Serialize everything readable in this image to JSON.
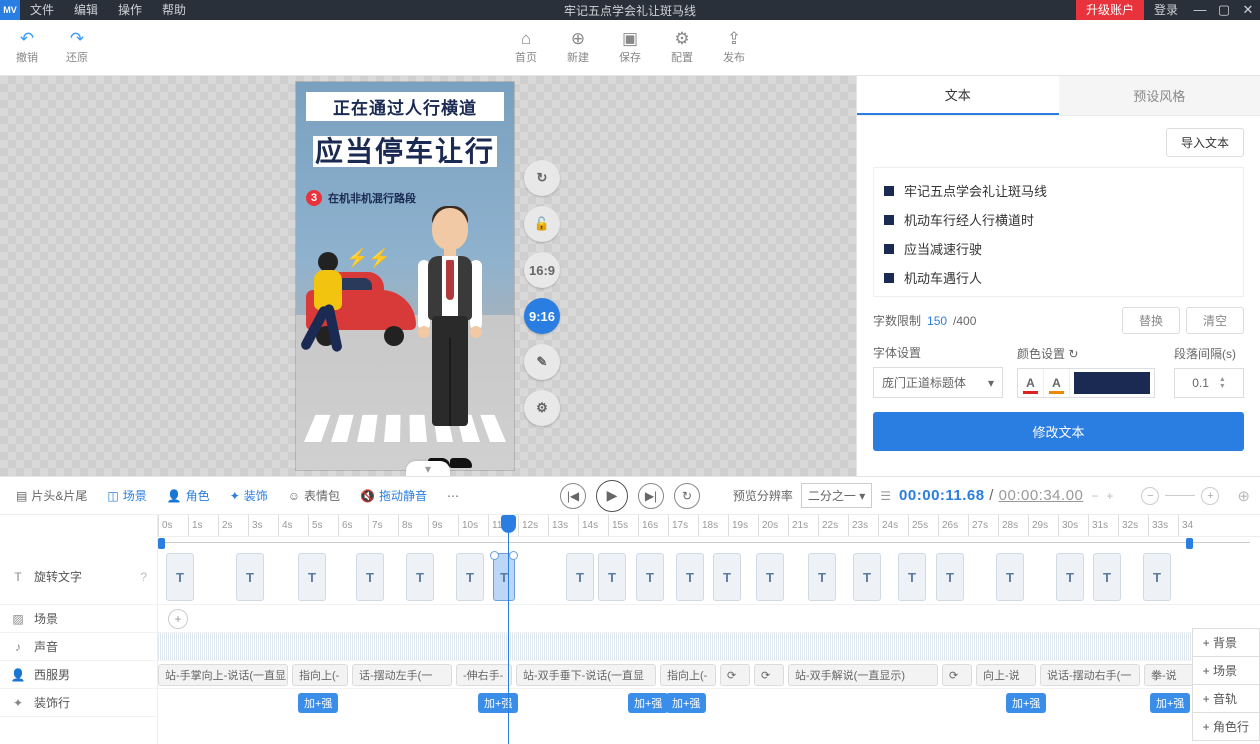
{
  "app": {
    "logo": "MV",
    "title": "牢记五点学会礼让斑马线"
  },
  "menu": [
    "文件",
    "编辑",
    "操作",
    "帮助"
  ],
  "titlebar_right": {
    "upgrade": "升级账户",
    "login": "登录"
  },
  "toolbar": {
    "undo": "撤销",
    "redo": "还原",
    "home": "首页",
    "new": "新建",
    "save": "保存",
    "config": "配置",
    "publish": "发布"
  },
  "stage": {
    "headline1": "正在通过人行横道",
    "headline2": "应当停车让行",
    "sub_num": "3",
    "sub_text": "在机非机混行路段",
    "tools": {
      "refresh": "↻",
      "lock": "🔓",
      "r169": "16:9",
      "r916": "9:16",
      "edit": "✎",
      "gear": "⚙"
    }
  },
  "panel": {
    "tab_text": "文本",
    "tab_style": "预设风格",
    "import": "导入文本",
    "items": [
      "牢记五点学会礼让斑马线",
      "机动车行经人行横道时",
      "应当减速行驶",
      "机动车遇行人"
    ],
    "limit_label": "字数限制",
    "limit_cur": "150",
    "limit_total": " /400",
    "replace": "替换",
    "clear": "清空",
    "font_label": "字体设置",
    "color_label": "颜色设置",
    "gap_label": "段落间隔(s)",
    "font_value": "庞门正道标题体",
    "gap_value": "0.1",
    "modify": "修改文本"
  },
  "tlbar": {
    "tabs": {
      "headtail": "片头&片尾",
      "scene": "场景",
      "role": "角色",
      "decor": "装饰",
      "emoji": "表情包",
      "dragmute": "拖动静音"
    },
    "preview_label": "预览分辨率",
    "preview_value": "二分之一",
    "time_cur": "00:00:11.68",
    "time_sep": " / ",
    "time_total": "00:00:34.00"
  },
  "ruler": [
    "0s",
    "1s",
    "2s",
    "3s",
    "4s",
    "5s",
    "6s",
    "7s",
    "8s",
    "9s",
    "10s",
    "11s",
    "12s",
    "13s",
    "14s",
    "15s",
    "16s",
    "17s",
    "18s",
    "19s",
    "20s",
    "21s",
    "22s",
    "23s",
    "24s",
    "25s",
    "26s",
    "27s",
    "28s",
    "29s",
    "30s",
    "31s",
    "32s",
    "33s",
    "34"
  ],
  "tracks": {
    "rotate": "旋转文字",
    "scene": "场景",
    "sound": "声音",
    "man": "西服男",
    "decor": "装饰行",
    "clips": [
      "站-手掌向上-说话(一直显",
      "指向上(-",
      "话-摆动左手(一",
      "-伸右手-",
      "站-双手垂下-说话(一直显",
      "指向上(-",
      "",
      "",
      "站-双手解说(一直显示)",
      "",
      "向上-说",
      "说话-摆动右手(一",
      "拳-说"
    ],
    "deco": "加+强",
    "rbtns": {
      "bg": "背景",
      "scene": "场景",
      "audio": "音轨",
      "role": "角色行"
    }
  }
}
